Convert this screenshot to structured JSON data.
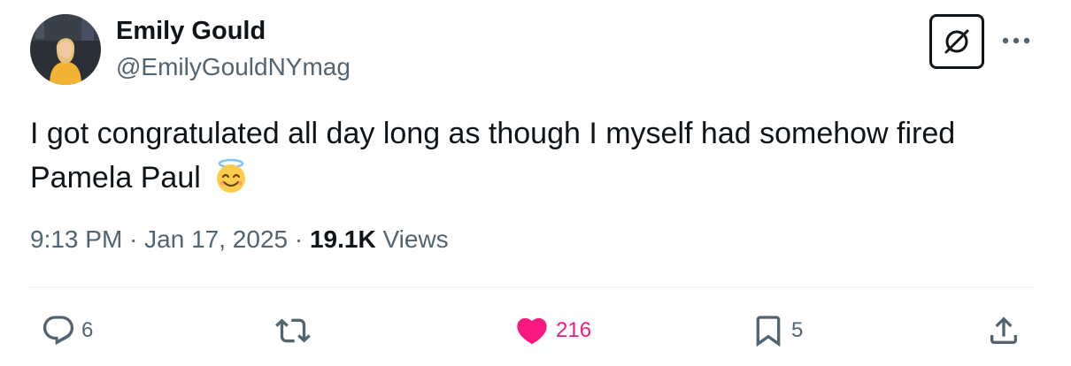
{
  "author": {
    "name": "Emily Gould",
    "handle": "@EmilyGouldNYmag"
  },
  "tweet": {
    "text": "I got congratulated all day long as though I myself had somehow fired Pamela Paul",
    "emoji": "smiling-face-with-halo"
  },
  "meta": {
    "time": "9:13 PM",
    "separator": "·",
    "date": "Jan 17, 2025",
    "views_count": "19.1K",
    "views_label": "Views"
  },
  "actions": {
    "replies": "6",
    "retweets": "",
    "likes": "216",
    "bookmarks": "5"
  },
  "colors": {
    "text": "#0f1419",
    "secondary": "#536471",
    "like": "#f91880",
    "divider": "#eff3f4"
  }
}
